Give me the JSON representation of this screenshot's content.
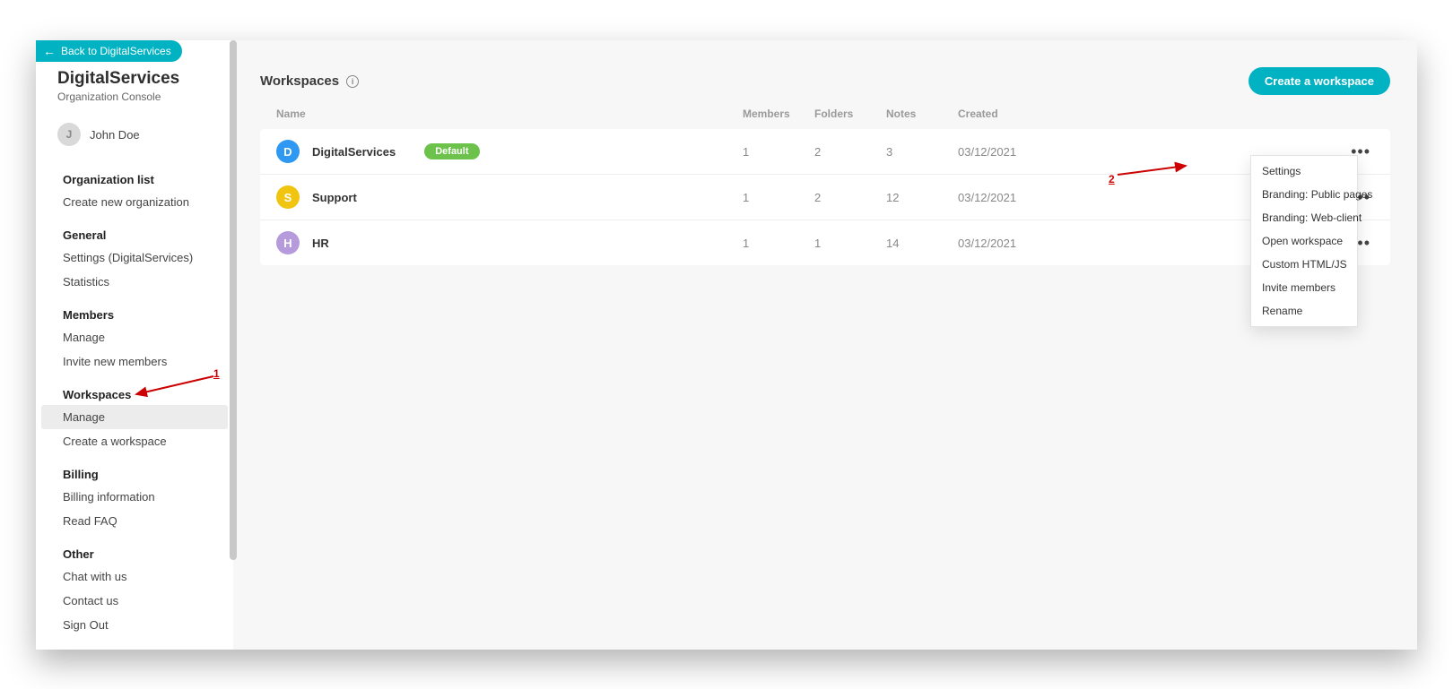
{
  "back_button": "Back to DigitalServices",
  "org": {
    "name": "DigitalServices",
    "subtitle": "Organization Console"
  },
  "user": {
    "initial": "J",
    "name": "John Doe"
  },
  "sidebar": {
    "groups": [
      {
        "heading": "Organization list",
        "items": [
          {
            "label": "Create new organization"
          }
        ]
      },
      {
        "heading": "General",
        "items": [
          {
            "label": "Settings (DigitalServices)"
          },
          {
            "label": "Statistics"
          }
        ]
      },
      {
        "heading": "Members",
        "items": [
          {
            "label": "Manage"
          },
          {
            "label": "Invite new members"
          }
        ]
      },
      {
        "heading": "Workspaces",
        "items": [
          {
            "label": "Manage",
            "selected": true
          },
          {
            "label": "Create a workspace"
          }
        ]
      },
      {
        "heading": "Billing",
        "items": [
          {
            "label": "Billing information"
          },
          {
            "label": "Read FAQ"
          }
        ]
      },
      {
        "heading": "Other",
        "items": [
          {
            "label": "Chat with us"
          },
          {
            "label": "Contact us"
          },
          {
            "label": "Sign Out"
          }
        ]
      }
    ]
  },
  "page": {
    "title": "Workspaces",
    "create_label": "Create a workspace"
  },
  "columns": {
    "name": "Name",
    "members": "Members",
    "folders": "Folders",
    "notes": "Notes",
    "created": "Created"
  },
  "rows": [
    {
      "initial": "D",
      "color": "#2f98f3",
      "name": "DigitalServices",
      "default": true,
      "members": "1",
      "folders": "2",
      "notes": "3",
      "created": "03/12/2021"
    },
    {
      "initial": "S",
      "color": "#f1c40f",
      "name": "Support",
      "default": false,
      "members": "1",
      "folders": "2",
      "notes": "12",
      "created": "03/12/2021"
    },
    {
      "initial": "H",
      "color": "#b59bdc",
      "name": "HR",
      "default": false,
      "members": "1",
      "folders": "1",
      "notes": "14",
      "created": "03/12/2021"
    }
  ],
  "badge_default_label": "Default",
  "menu": [
    "Settings",
    "Branding: Public pages",
    "Branding: Web-client",
    "Open workspace",
    "Custom HTML/JS",
    "Invite members",
    "Rename"
  ],
  "annotations": {
    "one": "1",
    "two": "2"
  }
}
